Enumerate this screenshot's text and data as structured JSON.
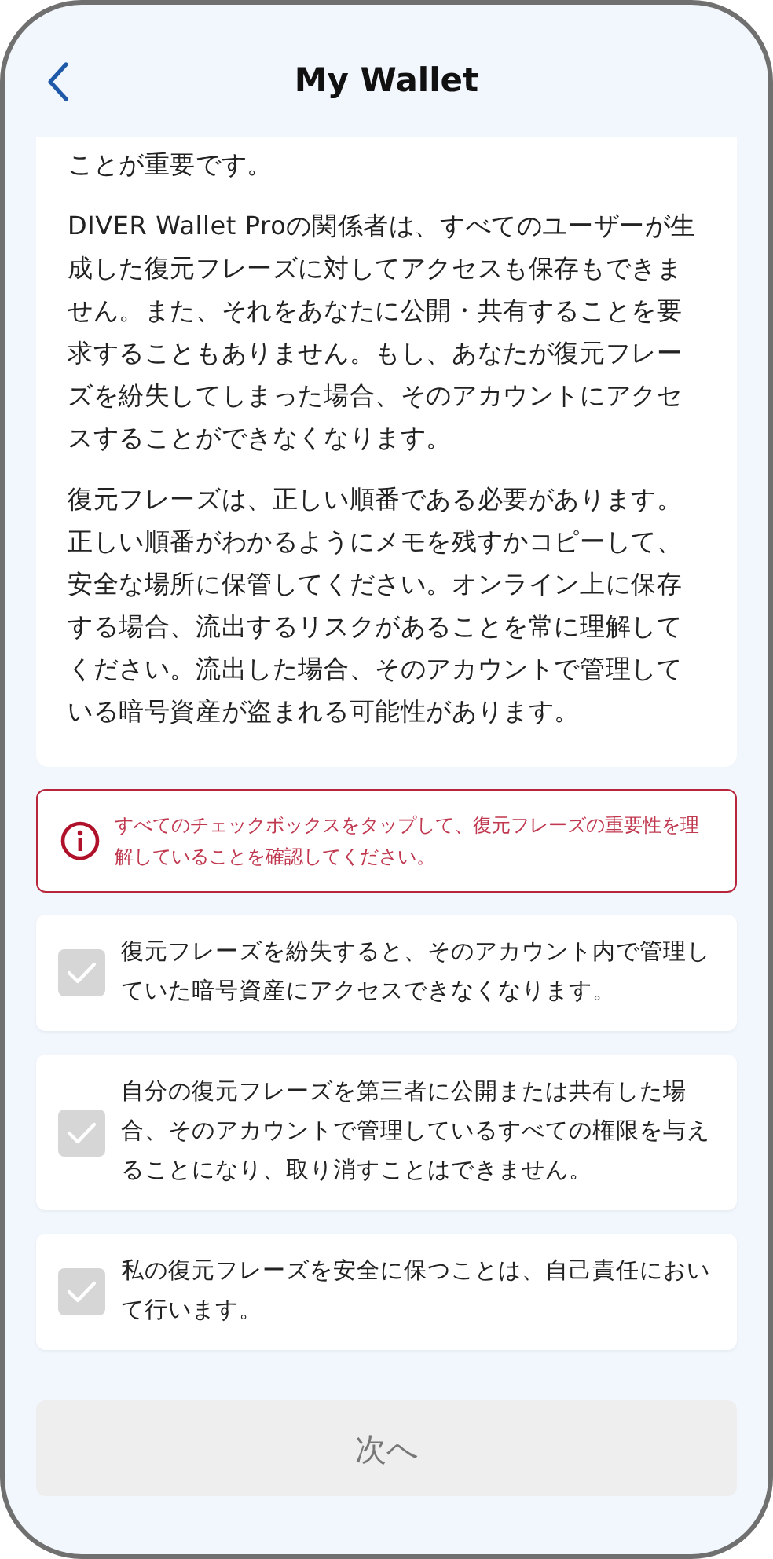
{
  "header": {
    "title": "My Wallet"
  },
  "info_paragraphs": [
    "ことが重要です。",
    "DIVER Wallet Proの関係者は、すべてのユーザーが生成した復元フレーズに対してアクセスも保存もできません。また、それをあなたに公開・共有することを要求することもありません。もし、あなたが復元フレーズを紛失してしまった場合、そのアカウントにアクセスすることができなくなります。",
    "復元フレーズは、正しい順番である必要があります。正しい順番がわかるようにメモを残すかコピーして、安全な場所に保管してください。オンライン上に保存する場合、流出するリスクがあることを常に理解してください。流出した場合、そのアカウントで管理している暗号資産が盗まれる可能性があります。"
  ],
  "alert": {
    "text": "すべてのチェックボックスをタップして、復元フレーズの重要性を理解していることを確認してください。"
  },
  "checklist": [
    {
      "label": "復元フレーズを紛失すると、そのアカウント内で管理していた暗号資産にアクセスできなくなります。",
      "checked": false
    },
    {
      "label": "自分の復元フレーズを第三者に公開または共有した場合、そのアカウントで管理しているすべての権限を与えることになり、取り消すことはできません。",
      "checked": false
    },
    {
      "label": "私の復元フレーズを安全に保つことは、自己責任において行います。",
      "checked": false
    }
  ],
  "next_button": {
    "label": "次へ",
    "disabled": true
  }
}
